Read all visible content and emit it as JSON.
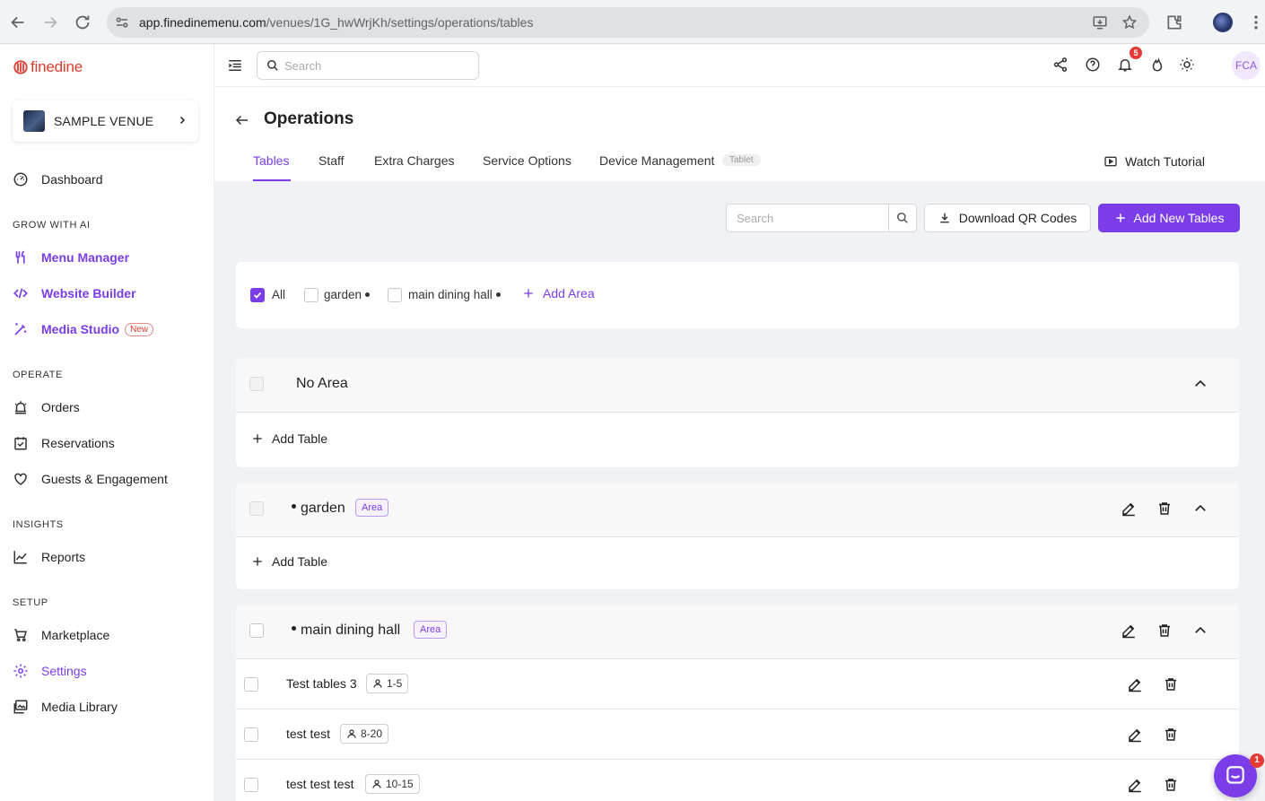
{
  "browser": {
    "url_host": "app.finedinemenu.com",
    "url_path": "/venues/1G_hwWrjKh/settings/operations/tables"
  },
  "sidebar": {
    "brand": "finedine",
    "venue_name": "SAMPLE VENUE",
    "dashboard": "Dashboard",
    "sections": {
      "grow": "GROW WITH AI",
      "operate": "OPERATE",
      "insights": "INSIGHTS",
      "setup": "SETUP"
    },
    "grow_items": [
      {
        "label": "Menu Manager",
        "icon": "fork-knife-icon"
      },
      {
        "label": "Website Builder",
        "icon": "code-icon"
      },
      {
        "label": "Media Studio",
        "icon": "magic-wand-icon",
        "badge": "New"
      }
    ],
    "operate_items": [
      {
        "label": "Orders",
        "icon": "bell-alarm-icon"
      },
      {
        "label": "Reservations",
        "icon": "calendar-check-icon"
      },
      {
        "label": "Guests & Engagement",
        "icon": "heart-icon"
      }
    ],
    "insights_items": [
      {
        "label": "Reports",
        "icon": "line-chart-icon"
      }
    ],
    "setup_items": [
      {
        "label": "Marketplace",
        "icon": "cart-icon"
      },
      {
        "label": "Settings",
        "icon": "gear-icon",
        "active": true
      },
      {
        "label": "Media Library",
        "icon": "images-icon"
      }
    ],
    "accent_color": "#7a3de8",
    "brand_color": "#e03b2e"
  },
  "header": {
    "search_placeholder": "Search",
    "notifications_count": "5",
    "avatar_initials": "FCA"
  },
  "page": {
    "title": "Operations",
    "tabs": [
      "Tables",
      "Staff",
      "Extra Charges",
      "Service Options",
      "Device Management"
    ],
    "tab_badge": "Tablet",
    "active_tab": "Tables",
    "watch_tutorial": "Watch Tutorial"
  },
  "toolbar": {
    "search_placeholder": "Search",
    "download_label": "Download QR Codes",
    "add_label": "Add New Tables"
  },
  "filters": {
    "all_label": "All",
    "all_checked": true,
    "areas": [
      "garden",
      "main dining hall"
    ],
    "add_area_label": "Add Area"
  },
  "groups": {
    "no_area": {
      "title": "No Area",
      "add_table": "Add Table"
    },
    "garden": {
      "title": "garden",
      "badge": "Area",
      "add_table": "Add Table"
    },
    "main": {
      "title": "main dining hall",
      "badge": "Area",
      "tables": [
        {
          "name": "Test tables 3",
          "capacity": "1-5"
        },
        {
          "name": "test test",
          "capacity": "8-20"
        },
        {
          "name": "test test test",
          "capacity": "10-15"
        }
      ]
    }
  },
  "chat": {
    "badge": "1"
  }
}
